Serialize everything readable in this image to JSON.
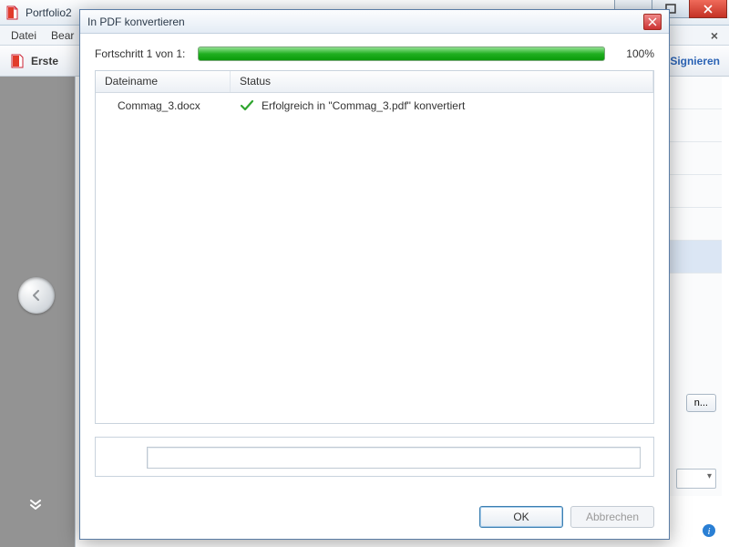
{
  "parent": {
    "title": "Portfolio2",
    "menu": {
      "file": "Datei",
      "edit": "Bear"
    },
    "toolbar": {
      "create": "Erste",
      "sign": "Signieren"
    },
    "side_options": "n..."
  },
  "dialog": {
    "title": "In PDF konvertieren",
    "progress_label": "Fortschritt 1 von 1:",
    "percent": "100%",
    "columns": {
      "filename": "Dateiname",
      "status": "Status"
    },
    "rows": [
      {
        "filename": "Commag_3.docx",
        "status": "Erfolgreich in \"Commag_3.pdf\" konvertiert"
      }
    ],
    "buttons": {
      "ok": "OK",
      "cancel": "Abbrechen"
    }
  }
}
